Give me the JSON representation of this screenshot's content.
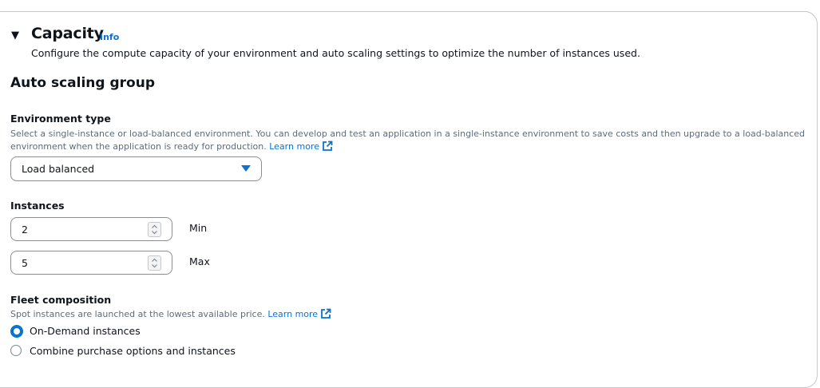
{
  "section": {
    "title": "Capacity",
    "info_link": "Info",
    "description": "Configure the compute capacity of your environment and auto scaling settings to optimize the number of instances used."
  },
  "asg": {
    "heading": "Auto scaling group",
    "environment_type": {
      "label": "Environment type",
      "help_line1": "Select a single-instance or load-balanced environment. You can develop and test an application in a single-instance environment to save costs and then upgrade to a load-balanced",
      "help_line2": "environment when the application is ready for production.",
      "learn_more": "Learn more",
      "selected": "Load balanced"
    },
    "instances": {
      "label": "Instances",
      "min_value": "2",
      "min_label": "Min",
      "max_value": "5",
      "max_label": "Max"
    },
    "fleet": {
      "label": "Fleet composition",
      "help": "Spot instances are launched at the lowest available price.",
      "learn_more": "Learn more",
      "options": [
        {
          "label": "On-Demand instances",
          "selected": true
        },
        {
          "label": "Combine purchase options and instances",
          "selected": false
        }
      ]
    }
  },
  "colors": {
    "accent": "#0972d3",
    "text": "#0f141a",
    "muted": "#5f6b7a",
    "border": "#8c8c94"
  },
  "icons": [
    "caret-down-icon",
    "external-link-icon",
    "dropdown-arrow-icon",
    "stepper-icon"
  ]
}
